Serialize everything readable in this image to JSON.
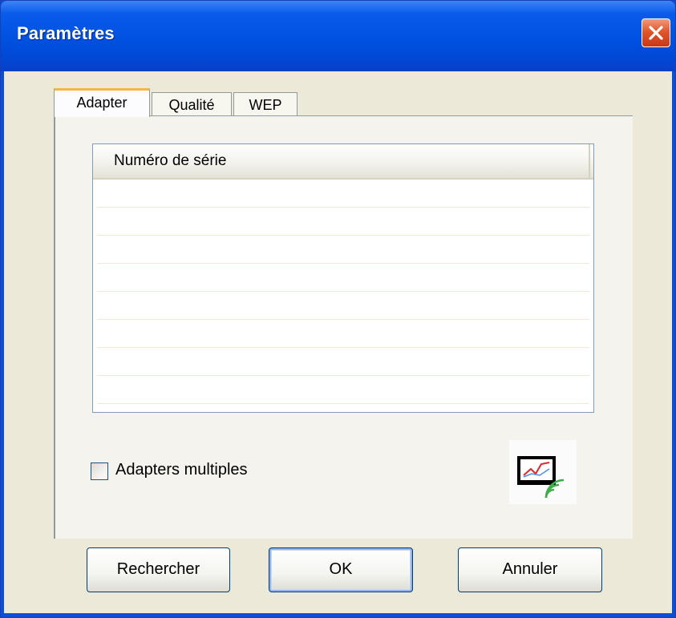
{
  "window": {
    "title": "Paramètres",
    "close_icon": "close-icon",
    "title_bar_color": "#0054e3",
    "close_button_color": "#e0572a"
  },
  "tabs": [
    {
      "label": "Adapter",
      "active": true
    },
    {
      "label": "Qualité",
      "active": false
    },
    {
      "label": "WEP",
      "active": false
    }
  ],
  "list": {
    "columns": [
      "Numéro de série"
    ],
    "rows": []
  },
  "options": {
    "multiple_adapters_label": "Adapters multiples",
    "multiple_adapters_checked": false
  },
  "icons": {
    "adapter_icon": "wireless-monitor-icon"
  },
  "buttons": {
    "search_label": "Rechercher",
    "ok_label": "OK",
    "cancel_label": "Annuler"
  }
}
